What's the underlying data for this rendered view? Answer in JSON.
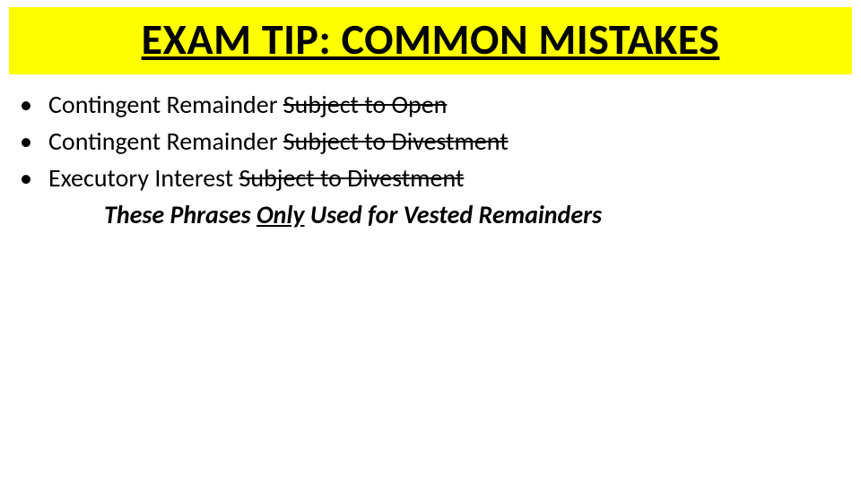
{
  "title": "EXAM TIP:  COMMON MISTAKES",
  "bullets": [
    {
      "prefix": "Contingent Remainder ",
      "strike": "Subject to Open"
    },
    {
      "prefix": "Contingent Remainder ",
      "strike": "Subject to Divestment"
    },
    {
      "prefix": "Executory Interest ",
      "strike": "Subject to Divestment"
    }
  ],
  "note": {
    "pre": "These Phrases ",
    "u": "Only",
    "post": " Used for Vested Remainders"
  },
  "bullet_char": "•"
}
